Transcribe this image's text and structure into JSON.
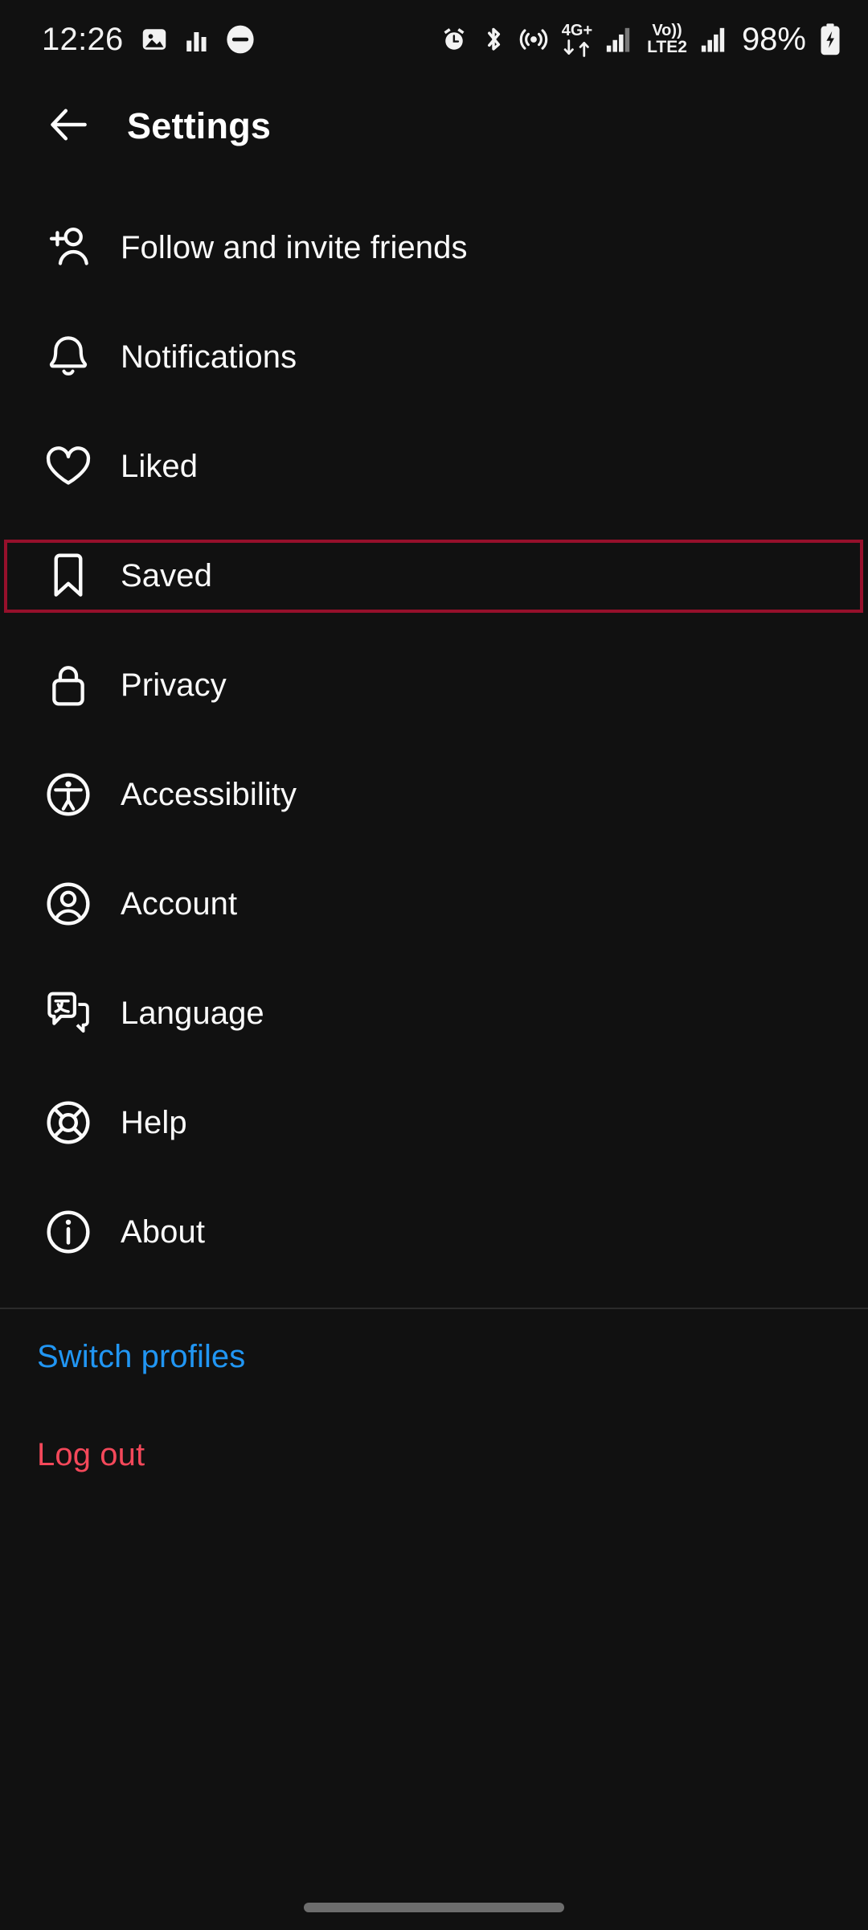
{
  "status_bar": {
    "time": "12:26",
    "battery_percent": "98%",
    "network_label": "4G+",
    "volte_label_top": "Vo))",
    "volte_label_bottom": "LTE2",
    "left_icons": [
      "image-icon",
      "bar-chart-icon",
      "do-not-disturb-icon"
    ],
    "right_icons": [
      "alarm-icon",
      "bluetooth-icon",
      "hotspot-icon",
      "mobile-data-arrows-icon",
      "signal-bars-icon",
      "volte-icon",
      "signal-bars-2-icon",
      "battery-charging-icon"
    ]
  },
  "header": {
    "back_icon": "arrow-left-icon",
    "title": "Settings"
  },
  "menu": {
    "items": [
      {
        "id": "follow-and-invite-friends",
        "label": "Follow and invite friends",
        "icon": "person-add-icon",
        "selected": false
      },
      {
        "id": "notifications",
        "label": "Notifications",
        "icon": "bell-icon",
        "selected": false
      },
      {
        "id": "liked",
        "label": "Liked",
        "icon": "heart-icon",
        "selected": false
      },
      {
        "id": "saved",
        "label": "Saved",
        "icon": "bookmark-icon",
        "selected": true
      },
      {
        "id": "privacy",
        "label": "Privacy",
        "icon": "lock-icon",
        "selected": false
      },
      {
        "id": "accessibility",
        "label": "Accessibility",
        "icon": "accessibility-icon",
        "selected": false
      },
      {
        "id": "account",
        "label": "Account",
        "icon": "account-circle-icon",
        "selected": false
      },
      {
        "id": "language",
        "label": "Language",
        "icon": "translate-icon",
        "selected": false
      },
      {
        "id": "help",
        "label": "Help",
        "icon": "lifebuoy-icon",
        "selected": false
      },
      {
        "id": "about",
        "label": "About",
        "icon": "info-circle-icon",
        "selected": false
      }
    ]
  },
  "footer": {
    "switch_profiles": "Switch profiles",
    "log_out": "Log out"
  },
  "colors": {
    "background": "#111111",
    "text": "#fafafa",
    "highlight_border": "#96102b",
    "link_blue": "#2196f3",
    "danger_red": "#f4485a",
    "divider": "#2b2b2b"
  }
}
